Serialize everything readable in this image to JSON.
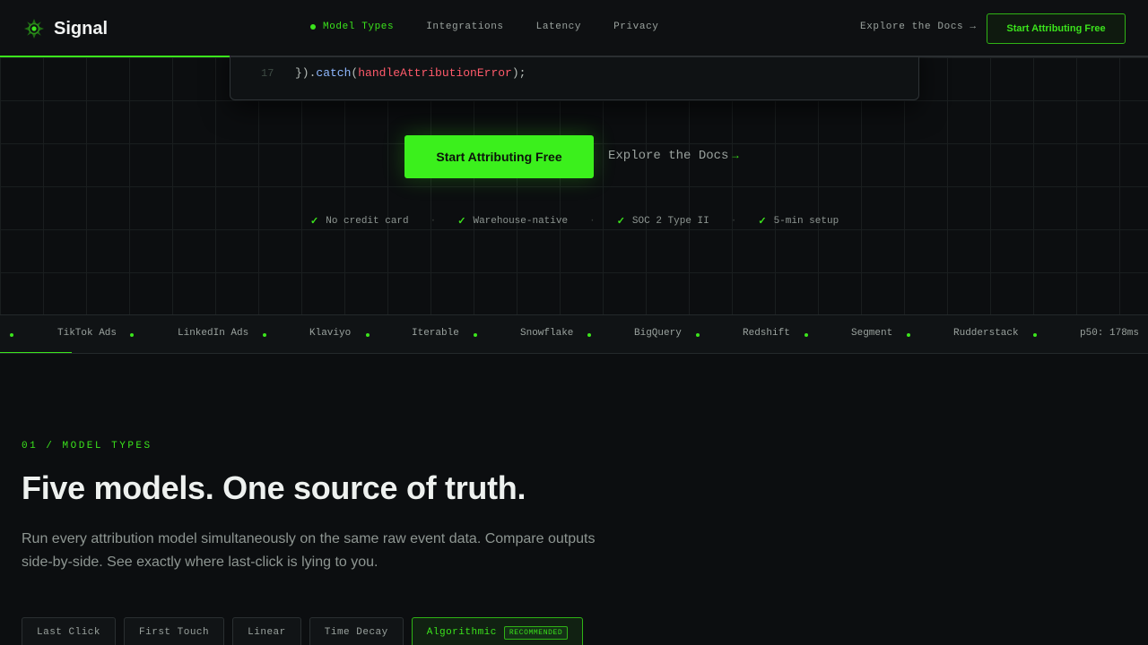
{
  "nav": {
    "brand": "Signal",
    "links": [
      {
        "label": "Model Types",
        "active": true
      },
      {
        "label": "Integrations",
        "active": false
      },
      {
        "label": "Latency",
        "active": false
      },
      {
        "label": "Privacy",
        "active": false
      }
    ],
    "docs_label": "Explore the Docs →",
    "cta_label": "Start Attributing Free"
  },
  "hero": {
    "code": {
      "line_number": "17",
      "prefix": "}).",
      "method": "catch",
      "open": "(",
      "arg": "handleAttributionError",
      "close": ");"
    },
    "cta_label": "Start Attributing Free",
    "docs_label": "Explore the Docs",
    "docs_arrow": "→",
    "trust": [
      "No credit card",
      "Warehouse-native",
      "SOC 2 Type II",
      "5-min setup"
    ],
    "trust_check": "✓",
    "trust_sep": "·"
  },
  "ticker": {
    "items": [
      "TikTok Ads",
      "LinkedIn Ads",
      "Klaviyo",
      "Iterable",
      "Snowflake",
      "BigQuery",
      "Redshift",
      "Segment",
      "Rudderstack"
    ],
    "latency": "p50: 178ms"
  },
  "models": {
    "eyebrow": "01 / MODEL TYPES",
    "title": "Five models. One source of truth.",
    "description": "Run every attribution model simultaneously on the same raw event data. Compare outputs side-by-side. See exactly where last-click is lying to you.",
    "tabs": [
      {
        "label": "Last Click",
        "active": false
      },
      {
        "label": "First Touch",
        "active": false
      },
      {
        "label": "Linear",
        "active": false
      },
      {
        "label": "Time Decay",
        "active": false
      },
      {
        "label": "Algorithmic",
        "active": true,
        "badge": "RECOMMENDED"
      }
    ]
  },
  "colors": {
    "accent": "#3be41c",
    "background": "#0c0e10",
    "nav_background": "#0e1012"
  },
  "icons": {
    "brand": "signal-logo-icon",
    "check": "check-icon"
  }
}
